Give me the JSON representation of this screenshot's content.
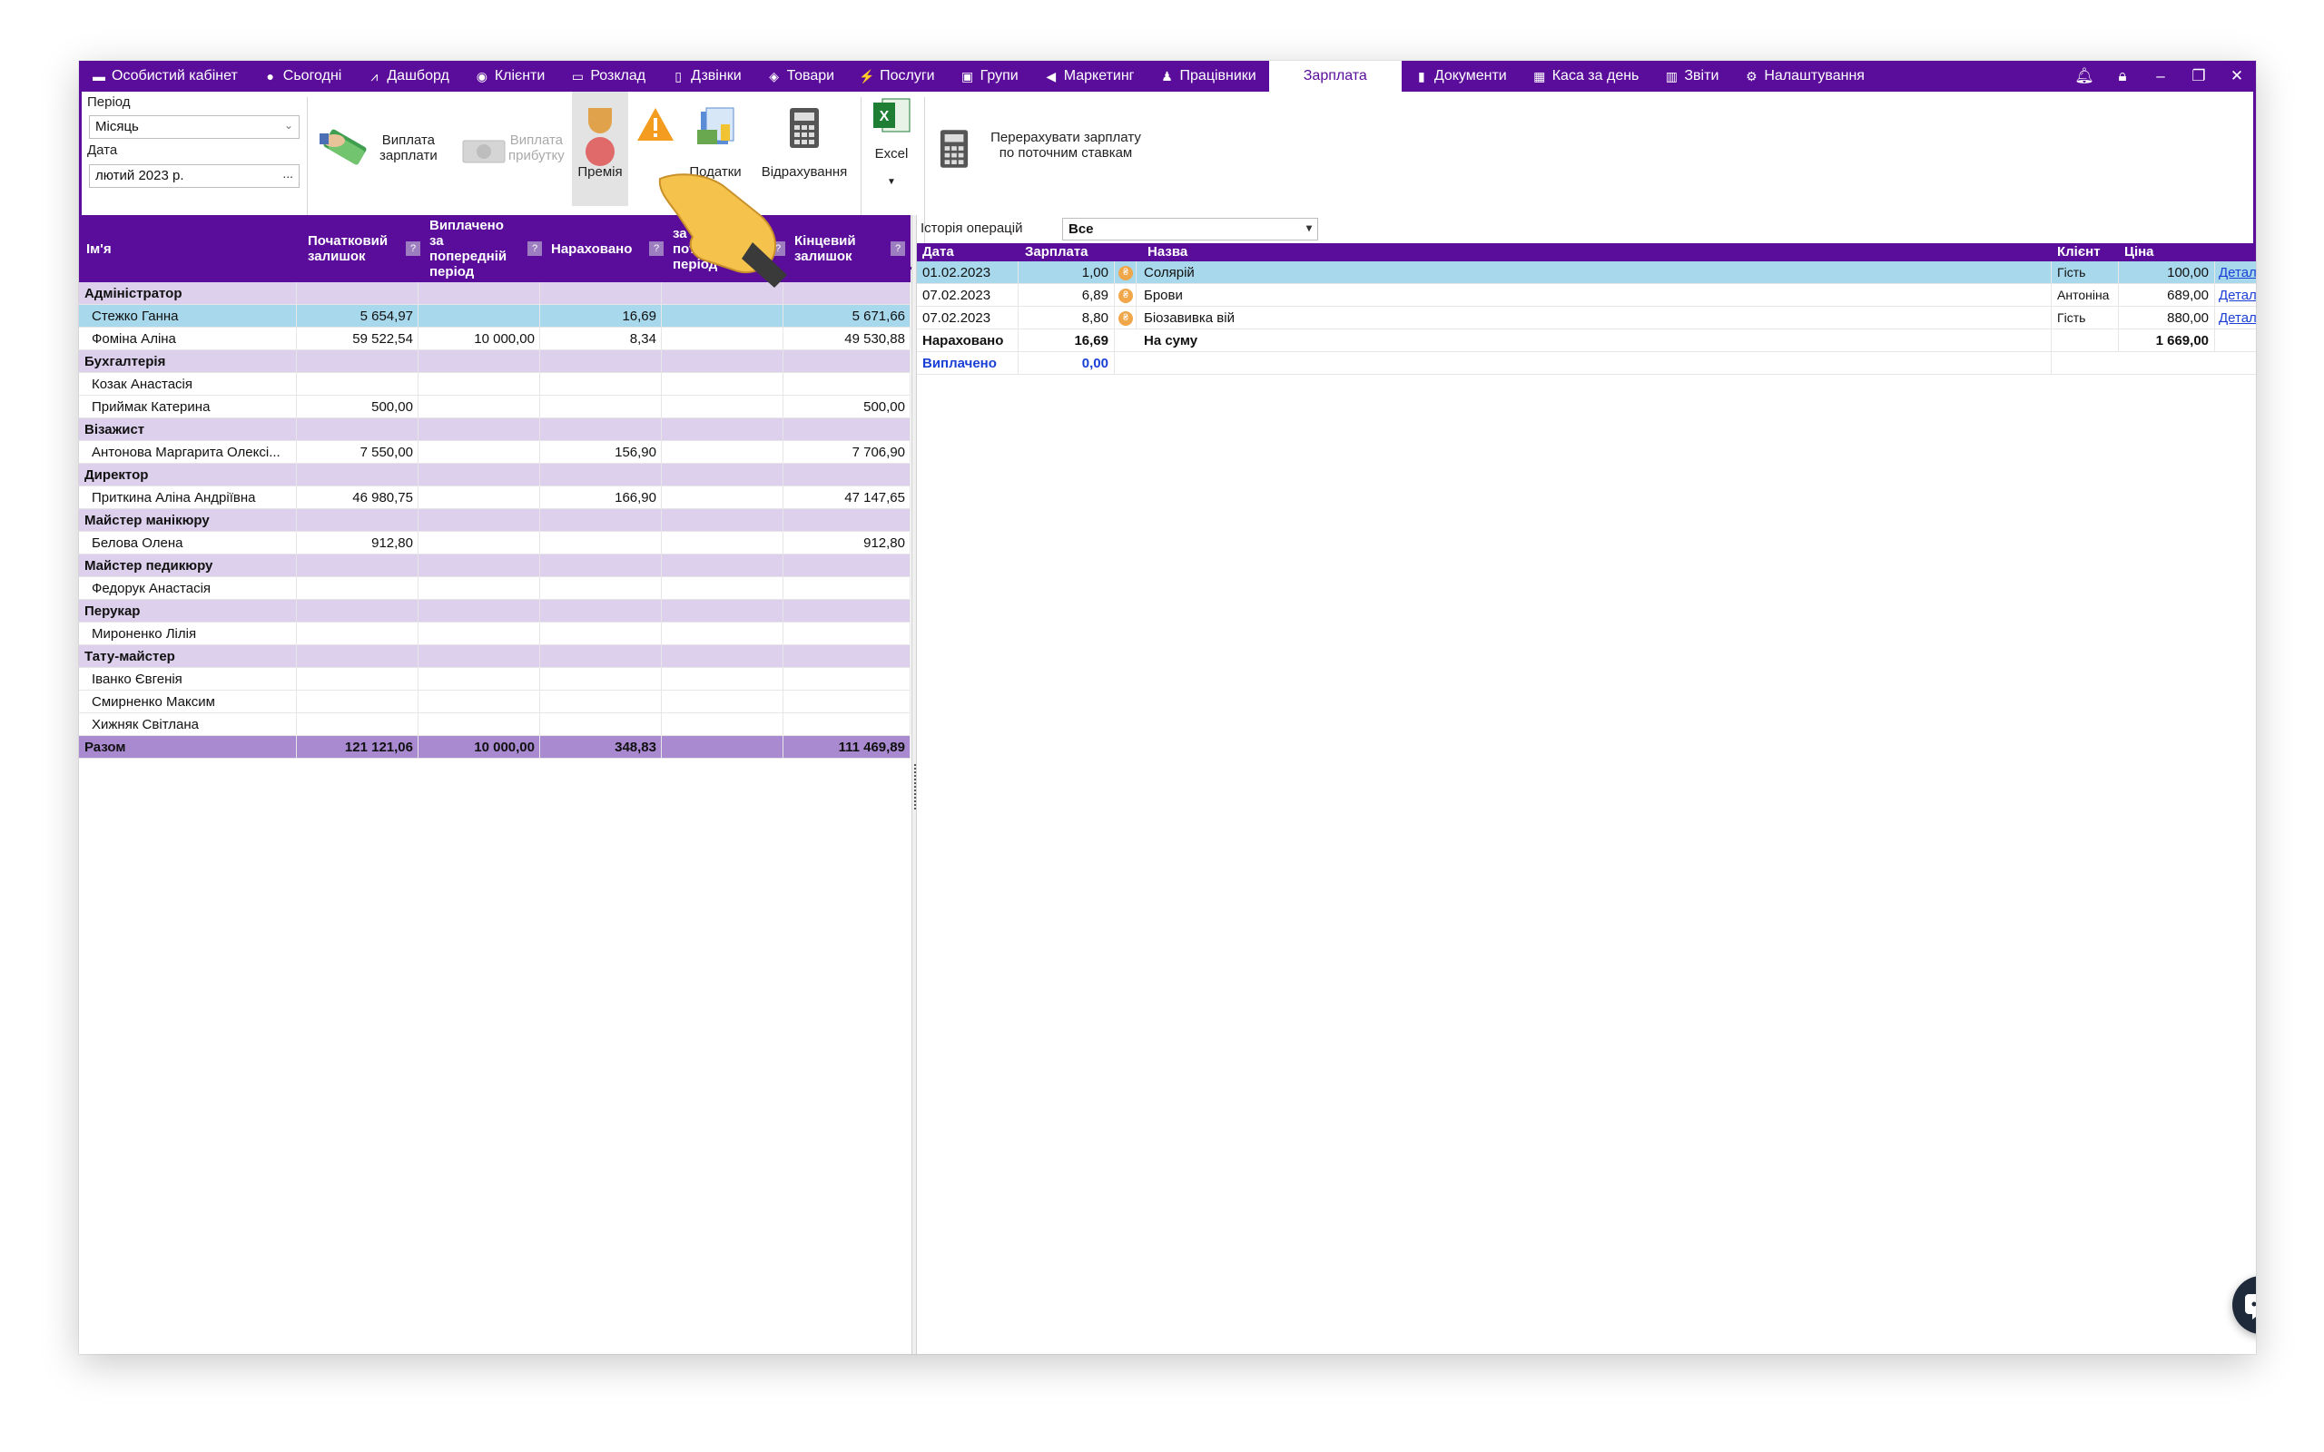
{
  "nav": {
    "items": [
      {
        "label": "Особистий кабінет",
        "icon": "cabinet-icon"
      },
      {
        "label": "Сьогодні",
        "icon": "today-icon"
      },
      {
        "label": "Дашборд",
        "icon": "dashboard-icon"
      },
      {
        "label": "Клієнти",
        "icon": "client-icon"
      },
      {
        "label": "Розклад",
        "icon": "calendar-icon"
      },
      {
        "label": "Дзвінки",
        "icon": "phone-icon"
      },
      {
        "label": "Товари",
        "icon": "box-icon"
      },
      {
        "label": "Послуги",
        "icon": "lightning-icon"
      },
      {
        "label": "Групи",
        "icon": "groups-icon"
      },
      {
        "label": "Маркетинг",
        "icon": "megaphone-icon"
      },
      {
        "label": "Працівники",
        "icon": "user-icon"
      },
      {
        "label": "Зарплата",
        "icon": ""
      },
      {
        "label": "Документи",
        "icon": "document-icon"
      },
      {
        "label": "Каса за день",
        "icon": "calculator-icon"
      },
      {
        "label": "Звіти",
        "icon": "bar-chart-icon"
      },
      {
        "label": "Налаштування",
        "icon": "gear-icon"
      }
    ],
    "active": "Зарплата"
  },
  "toolbar": {
    "period_label": "Період",
    "period_value": "Місяць",
    "date_label": "Дата",
    "date_value": "лютий  2023 р.",
    "date_btn": "...",
    "pay_salary_line1": "Виплата",
    "pay_salary_line2": "зарплати",
    "pay_profit_line1": "Виплата",
    "pay_profit_line2": "прибутку",
    "bonus": "Премія",
    "taxes": "Податки",
    "deductions": "Відрахування",
    "excel": "Excel",
    "recalc_line1": "Перерахувати зарплату",
    "recalc_line2": "по поточним ставкам"
  },
  "left_table": {
    "headers": {
      "name": "Ім'я",
      "opening": [
        "Початковий",
        "залишок"
      ],
      "paid_prev": [
        "Виплачено",
        "за",
        "попередній",
        "період"
      ],
      "accrued": "Нараховано",
      "paid_curr": [
        "за",
        "поточний",
        "період"
      ],
      "closing": [
        "Кінцевий",
        "залишок"
      ]
    },
    "rows": [
      {
        "type": "group",
        "name": "Адміністратор"
      },
      {
        "type": "row",
        "name": "Стежко Ганна",
        "opening": "5 654,97",
        "paid_prev": "",
        "accrued": "16,69",
        "paid_curr": "",
        "closing": "5 671,66",
        "selected": true
      },
      {
        "type": "row",
        "name": "Фоміна Аліна",
        "opening": "59 522,54",
        "paid_prev": "10 000,00",
        "accrued": "8,34",
        "paid_curr": "",
        "closing": "49 530,88"
      },
      {
        "type": "group",
        "name": "Бухгалтерія"
      },
      {
        "type": "row",
        "name": "Козак Анастасія",
        "opening": "",
        "paid_prev": "",
        "accrued": "",
        "paid_curr": "",
        "closing": ""
      },
      {
        "type": "row",
        "name": "Приймак Катерина",
        "opening": "500,00",
        "paid_prev": "",
        "accrued": "",
        "paid_curr": "",
        "closing": "500,00"
      },
      {
        "type": "group",
        "name": "Візажист"
      },
      {
        "type": "row",
        "name": "Антонова Маргарита Олексі...",
        "opening": "7 550,00",
        "paid_prev": "",
        "accrued": "156,90",
        "paid_curr": "",
        "closing": "7 706,90"
      },
      {
        "type": "group",
        "name": "Директор"
      },
      {
        "type": "row",
        "name": "Приткина Аліна Андріївна",
        "opening": "46 980,75",
        "paid_prev": "",
        "accrued": "166,90",
        "paid_curr": "",
        "closing": "47 147,65"
      },
      {
        "type": "group",
        "name": "Майстер манікюру"
      },
      {
        "type": "row",
        "name": "Белова Олена",
        "opening": "912,80",
        "paid_prev": "",
        "accrued": "",
        "paid_curr": "",
        "closing": "912,80"
      },
      {
        "type": "group",
        "name": "Майстер педикюру"
      },
      {
        "type": "row",
        "name": "Федорук Анастасія",
        "opening": "",
        "paid_prev": "",
        "accrued": "",
        "paid_curr": "",
        "closing": ""
      },
      {
        "type": "group",
        "name": "Перукар"
      },
      {
        "type": "row",
        "name": "Мироненко Лілія",
        "opening": "",
        "paid_prev": "",
        "accrued": "",
        "paid_curr": "",
        "closing": ""
      },
      {
        "type": "group",
        "name": "Тату-майстер"
      },
      {
        "type": "row",
        "name": "Іванко Євгенія",
        "opening": "",
        "paid_prev": "",
        "accrued": "",
        "paid_curr": "",
        "closing": ""
      },
      {
        "type": "row",
        "name": "Смирненко Максим",
        "opening": "",
        "paid_prev": "",
        "accrued": "",
        "paid_curr": "",
        "closing": ""
      },
      {
        "type": "row",
        "name": "Хижняк Світлана",
        "opening": "",
        "paid_prev": "",
        "accrued": "",
        "paid_curr": "",
        "closing": ""
      },
      {
        "type": "total",
        "name": "Разом",
        "opening": "121 121,06",
        "paid_prev": "10 000,00",
        "accrued": "348,83",
        "paid_curr": "",
        "closing": "111 469,89"
      }
    ]
  },
  "right_panel": {
    "history_label": "Історія операцій",
    "history_value": "Все",
    "headers": {
      "date": "Дата",
      "salary": "Зарплата",
      "name": "Назва",
      "client": "Клієнт",
      "price": "Ціна"
    },
    "rows": [
      {
        "date": "01.02.2023",
        "salary": "1,00",
        "name": "Солярій",
        "client": "Гість",
        "price": "100,00",
        "link": "Детальніше",
        "selected": true
      },
      {
        "date": "07.02.2023",
        "salary": "6,89",
        "name": "Брови",
        "client": "Антоніна",
        "price": "689,00",
        "link": "Детальніше"
      },
      {
        "date": "07.02.2023",
        "salary": "8,80",
        "name": "Біозавивка вій",
        "client": "Гість",
        "price": "880,00",
        "link": "Детальніше"
      }
    ],
    "accrued_label": "Нараховано",
    "accrued_value": "16,69",
    "sum_label": "На суму",
    "sum_value": "1 669,00",
    "paid_label": "Виплачено",
    "paid_value": "0,00"
  },
  "colors": {
    "accent": "#5a0d9a",
    "group_row": "#dcd0ec",
    "selected_row": "#a8d8ec",
    "total_row": "#a98ad0",
    "link": "#1a3fd6"
  }
}
